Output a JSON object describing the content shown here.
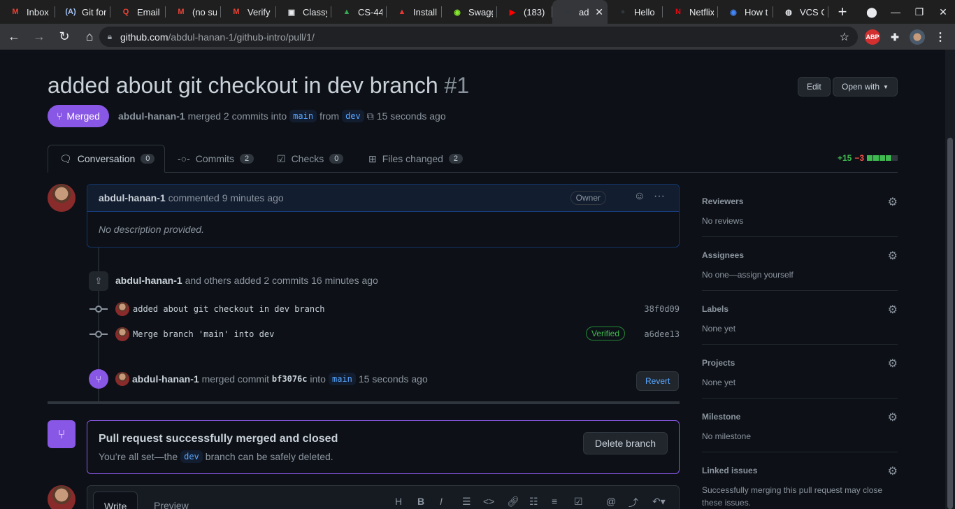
{
  "browser": {
    "tabs": [
      {
        "title": "Inbox",
        "fav": "M",
        "color": "#ea4335",
        "bg": "transparent"
      },
      {
        "title": "Git for",
        "fav": "(A)",
        "color": "#a8c7fa",
        "bg": "transparent"
      },
      {
        "title": "Email",
        "fav": "Q",
        "color": "#ea4335",
        "bg": "transparent"
      },
      {
        "title": "(no su",
        "fav": "M",
        "color": "#ea4335",
        "bg": "transparent"
      },
      {
        "title": "Verify",
        "fav": "M",
        "color": "#ea4335",
        "bg": "transparent"
      },
      {
        "title": "Classy",
        "fav": "▣",
        "color": "#e8eaed",
        "bg": "transparent"
      },
      {
        "title": "CS-44",
        "fav": "▲",
        "color": "#34a853",
        "bg": "transparent"
      },
      {
        "title": "Install",
        "fav": "▲",
        "color": "#e53935",
        "bg": "transparent"
      },
      {
        "title": "Swagg",
        "fav": "◉",
        "color": "#85ea2d",
        "bg": "transparent"
      },
      {
        "title": "(183)",
        "fav": "▶",
        "color": "#ff0000",
        "bg": "transparent"
      },
      {
        "title": "ad",
        "fav": "●",
        "color": "#30363d",
        "bg": "transparent",
        "active": true
      },
      {
        "title": "Hello",
        "fav": "●",
        "color": "#30363d",
        "bg": "transparent"
      },
      {
        "title": "Netflix",
        "fav": "N",
        "color": "#e50914",
        "bg": "transparent"
      },
      {
        "title": "How t",
        "fav": "◉",
        "color": "#4285f4",
        "bg": "transparent"
      },
      {
        "title": "VCS G",
        "fav": "◍",
        "color": "#e8eaed",
        "bg": "transparent"
      }
    ],
    "url_host": "github.com",
    "url_path": "/abdul-hanan-1/github-intro/pull/1/",
    "ext_abp": "ABP"
  },
  "pr": {
    "title": "added about git checkout in dev branch",
    "number": "#1",
    "edit_label": "Edit",
    "open_with_label": "Open with",
    "state_label": "Merged",
    "author": "abdul-hanan-1",
    "merged_text": "merged 2 commits into",
    "base": "main",
    "from_text": "from",
    "head": "dev",
    "time": "15 seconds ago"
  },
  "tabs": [
    {
      "label": "Conversation",
      "count": "0"
    },
    {
      "label": "Commits",
      "count": "2"
    },
    {
      "label": "Checks",
      "count": "0"
    },
    {
      "label": "Files changed",
      "count": "2"
    }
  ],
  "diffstat": {
    "additions": "+15",
    "deletions": "−3"
  },
  "comment": {
    "author": "abdul-hanan-1",
    "action": "commented 9 minutes ago",
    "badge": "Owner",
    "body": "No description provided."
  },
  "commits_event": {
    "author": "abdul-hanan-1",
    "text": "and others added 2 commits 16 minutes ago"
  },
  "commits": [
    {
      "message": "added about git checkout in dev branch",
      "sha": "38f0d09"
    },
    {
      "message": "Merge branch 'main' into dev",
      "sha": "a6dee13",
      "verified": "Verified"
    }
  ],
  "merge_event": {
    "author": "abdul-hanan-1",
    "text1": "merged commit",
    "commit": "bf3076c",
    "text2": "into",
    "base": "main",
    "time": "15 seconds ago",
    "revert_label": "Revert"
  },
  "merge_box": {
    "title": "Pull request successfully merged and closed",
    "text_before": "You’re all set—the",
    "branch": "dev",
    "text_after": "branch can be safely deleted.",
    "delete_label": "Delete branch"
  },
  "editor": {
    "write": "Write",
    "preview": "Preview"
  },
  "sidebar": [
    {
      "heading": "Reviewers",
      "value": "No reviews"
    },
    {
      "heading": "Assignees",
      "value": "No one—assign yourself"
    },
    {
      "heading": "Labels",
      "value": "None yet"
    },
    {
      "heading": "Projects",
      "value": "None yet"
    },
    {
      "heading": "Milestone",
      "value": "No milestone"
    },
    {
      "heading": "Linked issues",
      "value": "Successfully merging this pull request may close these issues."
    }
  ]
}
